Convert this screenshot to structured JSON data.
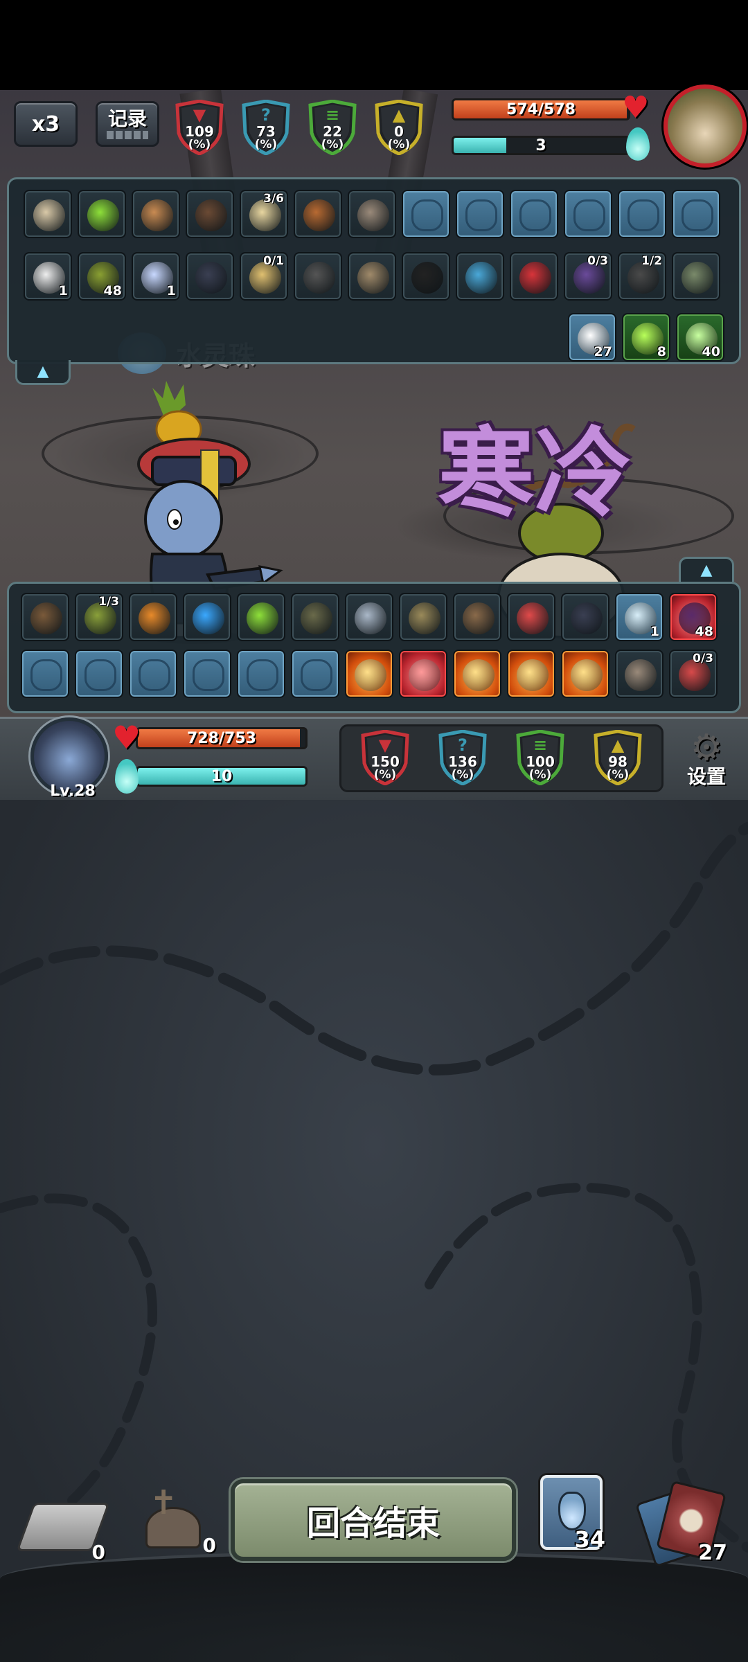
{
  "top": {
    "speed_label": "x3",
    "log_label": "记录"
  },
  "enemy": {
    "stats": [
      {
        "name": "attack",
        "value": "109",
        "unit": "(%)",
        "color": "#c8333a"
      },
      {
        "name": "mystery",
        "value": "73",
        "unit": "(%)",
        "color": "#3a9ab3"
      },
      {
        "name": "defense",
        "value": "22",
        "unit": "(%)",
        "color": "#4caa3a"
      },
      {
        "name": "power",
        "value": "0",
        "unit": "(%)",
        "color": "#c7b02a"
      }
    ],
    "hp_text": "574/578",
    "hp_fraction": 0.993,
    "energy_text": "3",
    "energy_fraction": 0.3
  },
  "enemy_items": {
    "row1": [
      {
        "icon": "claw-icon"
      },
      {
        "icon": "green-gem-icon"
      },
      {
        "icon": "bullet-icon"
      },
      {
        "icon": "log-icon"
      },
      {
        "icon": "scroll-icon",
        "top": "3/6"
      },
      {
        "icon": "bag-icon"
      },
      {
        "icon": "machine-icon"
      },
      {
        "icon": "rune-swirl-icon"
      },
      {
        "icon": "rune-skull-icon"
      },
      {
        "icon": "rune-runner-icon"
      },
      {
        "icon": "rune-dots-icon"
      },
      {
        "icon": "rune-arrow-icon"
      },
      {
        "icon": "rune-arc-icon"
      }
    ],
    "row2": [
      {
        "icon": "papers-icon",
        "count": "1"
      },
      {
        "icon": "durian-icon",
        "count": "48"
      },
      {
        "icon": "triangle-icon",
        "count": "1"
      },
      {
        "icon": "boot-icon"
      },
      {
        "icon": "lamp-icon",
        "top": "0/1"
      },
      {
        "icon": "trap-icon"
      },
      {
        "icon": "skull-helmet-icon"
      },
      {
        "icon": "sunglasses-icon"
      },
      {
        "icon": "amulet-icon"
      },
      {
        "icon": "glove-icon"
      },
      {
        "icon": "spellbook-icon",
        "top": "0/3"
      },
      {
        "icon": "binoculars-icon",
        "top": "1/2"
      },
      {
        "icon": "jar-icon"
      }
    ],
    "status": [
      {
        "icon": "frost-icon",
        "count": "27"
      },
      {
        "icon": "acid-icon",
        "count": "8"
      },
      {
        "icon": "poison-icon",
        "count": "40"
      }
    ],
    "relic_label": "水灵珠"
  },
  "combat_text": "寒冷",
  "player_items": {
    "row1": [
      {
        "icon": "scarecrow-icon"
      },
      {
        "icon": "plant-icon",
        "top": "1/3"
      },
      {
        "icon": "chainsaw-icon"
      },
      {
        "icon": "wave-icon"
      },
      {
        "icon": "green-gem-icon"
      },
      {
        "icon": "mine-icon"
      },
      {
        "icon": "kunai-icon"
      },
      {
        "icon": "cat-helmet-icon"
      },
      {
        "icon": "owl-icon"
      },
      {
        "icon": "red-monster-icon"
      },
      {
        "icon": "boot-icon"
      },
      {
        "icon": "shield-icon",
        "count": "1"
      },
      {
        "icon": "curse-icon",
        "count": "48"
      }
    ],
    "row2": [
      {
        "icon": "rune-sprint-icon"
      },
      {
        "icon": "rune-muscle-icon"
      },
      {
        "icon": "rune-dragon-icon"
      },
      {
        "icon": "rune-helmet-icon"
      },
      {
        "icon": "rune-whip-icon"
      },
      {
        "icon": "rune-kick-icon"
      },
      {
        "icon": "fire-boot-icon"
      },
      {
        "icon": "red-boot-icon"
      },
      {
        "icon": "fire-boot-icon"
      },
      {
        "icon": "fire-boot-icon"
      },
      {
        "icon": "fire-boot-icon"
      },
      {
        "icon": "machine-icon"
      },
      {
        "icon": "slot-machine-icon",
        "top": "0/3"
      }
    ]
  },
  "player": {
    "level": "Lv.28",
    "hp_text": "728/753",
    "hp_fraction": 0.967,
    "energy_text": "10",
    "energy_fraction": 1.0,
    "stats": [
      {
        "name": "attack",
        "value": "150",
        "unit": "(%)",
        "color": "#c8333a"
      },
      {
        "name": "mystery",
        "value": "136",
        "unit": "(%)",
        "color": "#3a9ab3"
      },
      {
        "name": "defense",
        "value": "100",
        "unit": "(%)",
        "color": "#4caa3a"
      },
      {
        "name": "power",
        "value": "98",
        "unit": "(%)",
        "color": "#c7b02a"
      }
    ],
    "settings_label": "设置"
  },
  "bottom": {
    "draw_pile_count": "0",
    "grave_count": "0",
    "end_turn_label": "回合结束",
    "potion_count": "34",
    "deck_count": "27"
  },
  "colors": {
    "hp": "#e0562a",
    "energy": "#56d8d4",
    "panel_border": "#5d7a80"
  }
}
